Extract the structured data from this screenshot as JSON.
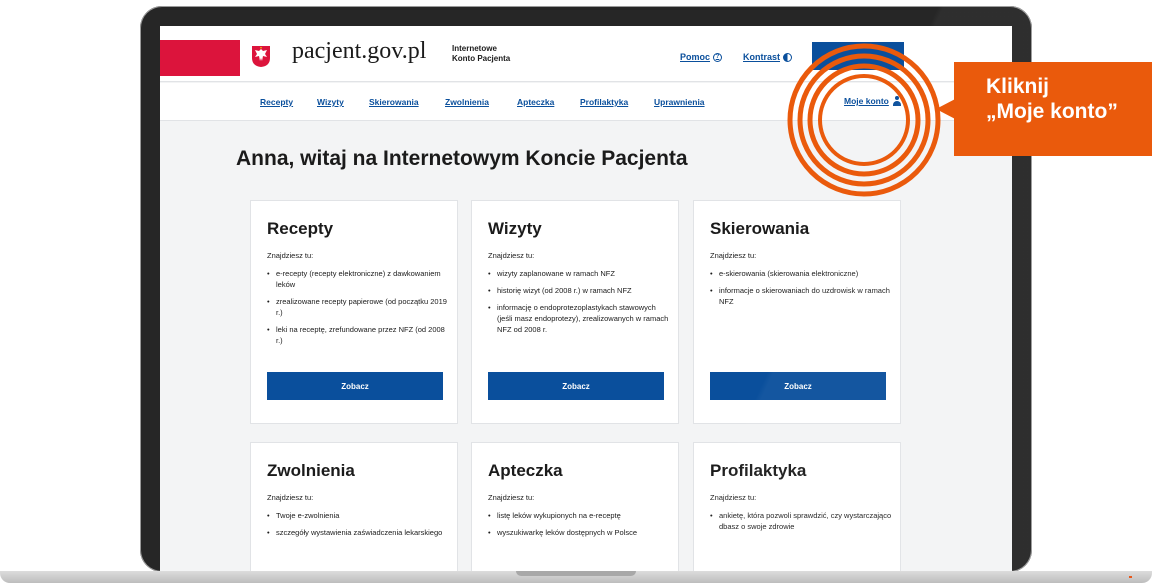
{
  "header": {
    "brand": "pacjent.gov.pl",
    "subtitle_line1": "Internetowe",
    "subtitle_line2": "Konto Pacjenta",
    "help": "Pomoc",
    "contrast": "Kontrast",
    "login_label": ""
  },
  "nav": {
    "items": [
      "Recepty",
      "Wizyty",
      "Skierowania",
      "Zwolnienia",
      "Apteczka",
      "Profilaktyka",
      "Uprawnienia"
    ],
    "account": "Moje konto"
  },
  "greeting": "Anna, witaj na Internetowym Koncie Pacjenta",
  "cards": [
    {
      "title": "Recepty",
      "intro": "Znajdziesz tu:",
      "items": [
        "e-recepty (recepty elektroniczne) z dawkowaniem leków",
        "zrealizowane recepty papierowe (od początku 2019 r.)",
        "leki na receptę, zrefundowane przez NFZ (od 2008 r.)"
      ],
      "button": "Zobacz"
    },
    {
      "title": "Wizyty",
      "intro": "Znajdziesz tu:",
      "items": [
        "wizyty zaplanowane w ramach NFZ",
        "historię wizyt (od 2008 r.) w ramach NFZ",
        "informację o endoprotezoplastykach stawowych (jeśli masz endoprotezy), zrealizowanych w ramach NFZ od 2008 r."
      ],
      "button": "Zobacz"
    },
    {
      "title": "Skierowania",
      "intro": "Znajdziesz tu:",
      "items": [
        "e-skierowania (skierowania elektroniczne)",
        "informacje o skierowaniach do uzdrowisk w ramach NFZ"
      ],
      "button": "Zobacz"
    },
    {
      "title": "Zwolnienia",
      "intro": "Znajdziesz tu:",
      "items": [
        "Twoje e-zwolnienia",
        "szczegóły wystawienia zaświadczenia lekarskiego"
      ]
    },
    {
      "title": "Apteczka",
      "intro": "Znajdziesz tu:",
      "items": [
        "listę leków wykupionych na e-receptę",
        "wyszukiwarkę leków dostępnych w Polsce"
      ]
    },
    {
      "title": "Profilaktyka",
      "intro": "Znajdziesz tu:",
      "items": [
        "ankietę, która pozwoli sprawdzić, czy wystarczająco dbasz o swoje zdrowie"
      ]
    }
  ],
  "callout": {
    "line1": "Kliknij",
    "line2": "„Moje konto”"
  },
  "colors": {
    "primary": "#0a4f9c",
    "flag_red": "#dc143c",
    "callout_orange": "#ea5a0c"
  }
}
